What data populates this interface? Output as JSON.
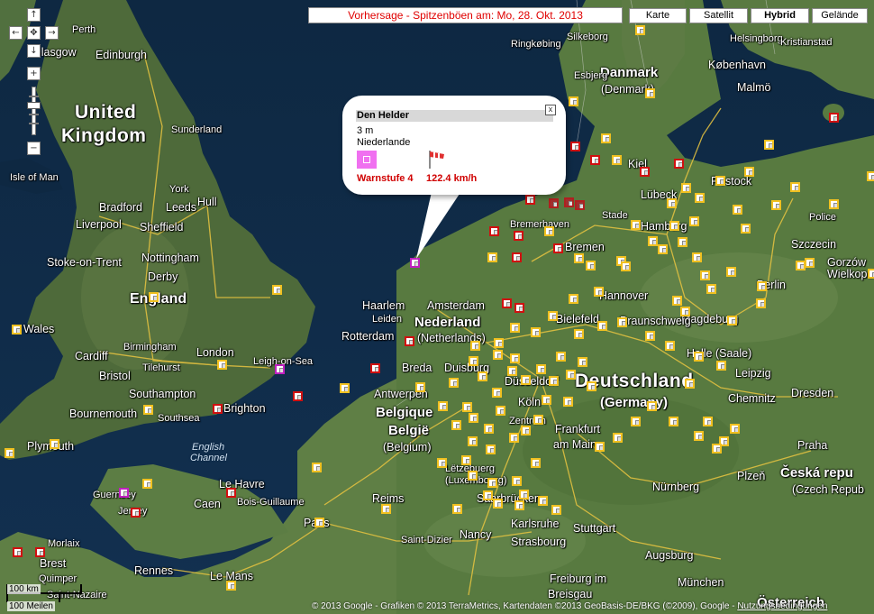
{
  "title": "Vorhersage - Spitzenböen am: Mo, 28. Okt. 2013",
  "map_types": [
    {
      "label": "Karte",
      "active": false
    },
    {
      "label": "Satellit",
      "active": false
    },
    {
      "label": "Hybrid",
      "active": true
    },
    {
      "label": "Gelände",
      "active": false
    }
  ],
  "nav": {
    "up": "↑",
    "left": "←",
    "center": "✥",
    "right": "→",
    "down": "↓",
    "zoom_in": "+",
    "zoom_out": "−"
  },
  "info_window": {
    "station": "Den Helder",
    "altitude": "3 m",
    "country": "Niederlande",
    "warning": "Warnstufe 4",
    "speed": "122.4  km/h",
    "close": "x"
  },
  "scale": {
    "km": "100 km",
    "miles": "100 Meilen"
  },
  "copyright": "© 2013 Google - Grafiken © 2013 TerraMetrics, Kartendaten ©2013 GeoBasis-DE/BKG (©2009), Google -",
  "copyright_link": "Nutzungsbedingungen",
  "countries": [
    {
      "text": "United",
      "cls": "xl"
    },
    {
      "text": "Kingdom",
      "cls": "xl"
    },
    {
      "text": "Danmark",
      "cls": "xls"
    },
    {
      "text": "(Denmark)",
      "cls": "m"
    },
    {
      "text": "Nederland",
      "cls": "xls"
    },
    {
      "text": "(Netherlands)",
      "cls": "m"
    },
    {
      "text": "Deutschland",
      "cls": "xl"
    },
    {
      "text": "(Germany)",
      "cls": "xls"
    },
    {
      "text": "Belgique",
      "cls": "xls"
    },
    {
      "text": "België",
      "cls": "xls"
    },
    {
      "text": "(Belgium)",
      "cls": "m"
    },
    {
      "text": "Česká repu",
      "cls": "xls"
    },
    {
      "text": "(Czech Repub",
      "cls": "m"
    },
    {
      "text": "Österreich",
      "cls": "xls"
    },
    {
      "text": "Lëtzebuerg",
      "cls": "s"
    },
    {
      "text": "(Luxembourg)",
      "cls": "s"
    },
    {
      "text": "Wales",
      "cls": "m"
    }
  ],
  "cities": [
    "Perth",
    "Glasgow",
    "Edinburgh",
    "Sunderland",
    "Isle of Man",
    "York",
    "Bradford",
    "Leeds",
    "Hull",
    "Liverpool",
    "Sheffield",
    "Stoke-on-Trent",
    "Nottingham",
    "Derby",
    "England",
    "Birmingham",
    "Cardiff",
    "Bristol",
    "London",
    "Tilehurst",
    "Leigh-on-Sea",
    "Southampton",
    "Brighton",
    "Bournemouth",
    "Southsea",
    "Plymouth",
    "Guernsey",
    "Jersey",
    "Le Havre",
    "Caen",
    "Bois-Guillaume",
    "Reims",
    "Paris",
    "Morlaix",
    "Brest",
    "Quimper",
    "Rennes",
    "Le Mans",
    "Saint-Nazaire",
    "Haarlem",
    "Amsterdam",
    "Leiden",
    "Rotterdam",
    "Breda",
    "Duisburg",
    "Antwerpen",
    "Düsseldorf",
    "Köln",
    "Zentrum",
    "Frankfurt",
    "am Main",
    "Saarbrücken",
    "Karlsruhe",
    "Stuttgart",
    "Strasbourg",
    "Nancy",
    "Saint-Dizier",
    "Freiburg im",
    "Breisgau",
    "Augsburg",
    "München",
    "Nürnberg",
    "Plzeň",
    "Praha",
    "Dresden",
    "Chemnitz",
    "Leipzig",
    "Halle (Saale)",
    "Magdeburg",
    "Braunschweig",
    "Hannover",
    "Bielefeld",
    "Berlin",
    "Hamburg",
    "Bremen",
    "Lübeck",
    "Kiel",
    "Rostock",
    "Szczecin",
    "Police",
    "Gorzów",
    "Wielkopolski",
    "Silkeborg",
    "Ringkøbing",
    "Helsingborg",
    "Kristianstad",
    "København",
    "Malmö",
    "Esbjerg",
    "Stade",
    "Bremerhaven"
  ],
  "water": [
    "English",
    "Channel"
  ]
}
